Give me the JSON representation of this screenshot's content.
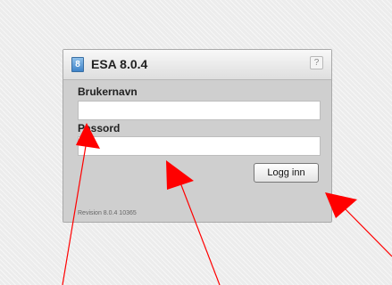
{
  "dialog": {
    "title": "ESA 8.0.4",
    "app_icon_glyph": "8",
    "help_glyph": "?",
    "username_label": "Brukernavn",
    "username_value": "",
    "password_label": "Passord",
    "password_value": "",
    "login_button": "Logg inn",
    "version_text": "Revision 8.0.4 10365"
  },
  "icons": {
    "app": "app-icon",
    "help": "help-icon"
  },
  "annotation": {
    "arrow_color": "#ff0000"
  }
}
